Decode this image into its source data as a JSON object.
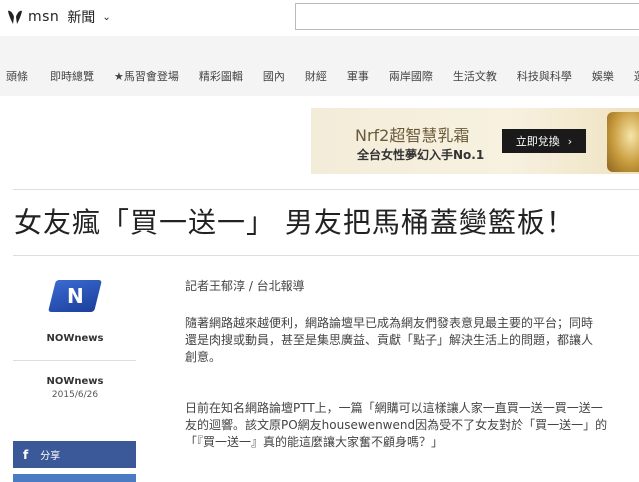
{
  "header": {
    "brand": "msn",
    "section": "新聞",
    "search_placeholder": ""
  },
  "nav": {
    "items": [
      "頭條",
      "即時總覽",
      "★馬習會登場",
      "精彩圖輯",
      "國內",
      "財經",
      "軍事",
      "兩岸國際",
      "生活文教",
      "科技與科學",
      "娛樂",
      "運"
    ]
  },
  "ad": {
    "brand": "Nrf2超智慧乳霜",
    "slogan": "全台女性夢幻入手No.1",
    "cta": "立即兌換",
    "cta_arrow": "›"
  },
  "article": {
    "headline": "女友瘋「買一送一」 男友把馬桶蓋變籃板！",
    "byline": "記者王郁淳 / 台北報導",
    "paragraph1": [
      "隨著網路越來越便利，網路論壇早已成為網友們發表意見最主要的平台；同時",
      "還是肉搜或動員，甚至是集思廣益、貢獻「點子」解決生活上的問題，都讓人",
      "創意。"
    ],
    "paragraph2": [
      "日前在知名網路論壇PTT上，一篇「網購可以這樣讓人家一直買一送一買一送一",
      "友的迴響。該文原PO網友housewenwend因為受不了女友對於「買一送一」的",
      "「『買一送一』真的能這麼讓大家奮不顧身嗎？」"
    ]
  },
  "source": {
    "logo_text": "N",
    "name": "NOWnews",
    "name2": "NOWnews",
    "date": "2015/6/26"
  },
  "share": {
    "fb_icon": "f",
    "fb_label": "分享"
  },
  "colors": {
    "nav_bg": "#f4f4f4",
    "fb_blue": "#3b5998",
    "nownews_blue": "#1b3f9b"
  }
}
